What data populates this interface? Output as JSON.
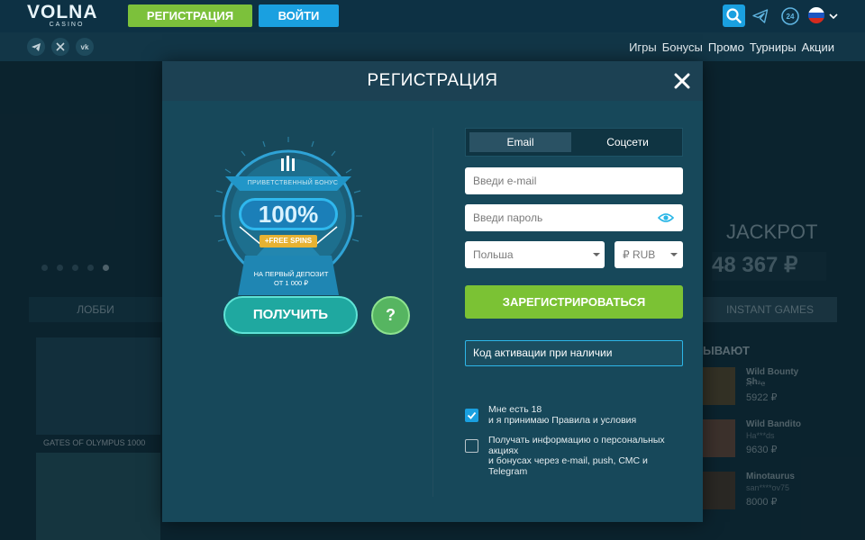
{
  "header": {
    "logo_main": "VOLNA",
    "logo_sub": "CASINO",
    "register_label": "РЕГИСТРАЦИЯ",
    "login_label": "ВОЙТИ"
  },
  "subnav": {
    "social": [
      "tg",
      "x",
      "vk"
    ],
    "links": [
      "Игры",
      "Бонусы",
      "Промо",
      "Турниры",
      "Акции"
    ]
  },
  "background": {
    "lobby_tab": "ЛОББИ",
    "instant_tab": "INSTANT GAMES",
    "jackpot_title": "JACKPOT",
    "jackpot_value": "48 367 ₽",
    "game_caption": "GATES OF OLYMPUS 1000",
    "wins_title": "ЫВАЮТ",
    "wins": [
      {
        "name": "Wild Bounty Sh...",
        "user": "A***e",
        "amount": "5922 ₽"
      },
      {
        "name": "Wild Bandito",
        "user": "Ha***ds",
        "amount": "9630 ₽"
      },
      {
        "name": "Minotaurus",
        "user": "san****ov75",
        "amount": "8000 ₽"
      }
    ]
  },
  "modal": {
    "title": "РЕГИСТРАЦИЯ",
    "bonus": {
      "label_top": "ПРИВЕТСТВЕННЫЙ БОНУС",
      "percent": "100%",
      "free_spins": "+FREE SPINS",
      "deposit_line1": "НА ПЕРВЫЙ ДЕПОЗИТ",
      "deposit_line2": "ОТ 1 000 ₽"
    },
    "get_button": "ПОЛУЧИТЬ",
    "help_button": "?",
    "tabs": [
      "Email",
      "Соцсети"
    ],
    "email_placeholder": "Введи e-mail",
    "password_placeholder": "Введи пароль",
    "country": "Польша",
    "currency": "₽ RUB",
    "submit": "ЗАРЕГИСТРИРОВАТЬСЯ",
    "promo_placeholder": "Код активации при наличии",
    "consent_age": {
      "checked": true,
      "line1": "Мне есть 18",
      "line2": "и я принимаю Правила и условия"
    },
    "consent_news": {
      "checked": false,
      "line1": "Получать информацию о персональных",
      "line2": "акциях",
      "line3": "и бонусах через e-mail, push, СМС и",
      "line4": "Telegram"
    }
  },
  "colors": {
    "accent_green": "#7bc234",
    "accent_blue": "#1aa0e0",
    "modal_bg": "#17485a"
  }
}
